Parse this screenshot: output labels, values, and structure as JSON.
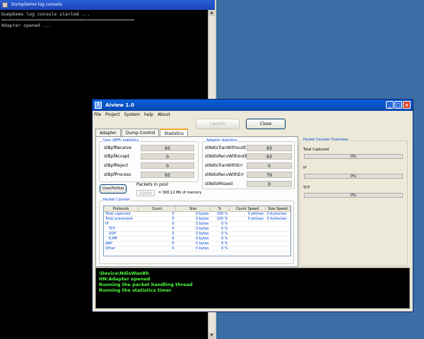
{
  "console": {
    "title": "DumpDemo log console",
    "lines": [
      "DumpDemo log console started ...",
      "================================================",
      "Adapter opened ..."
    ]
  },
  "app": {
    "title": "Aiview 1.0",
    "menu": [
      "File",
      "Project",
      "System",
      "help",
      "About"
    ],
    "buttons": {
      "launch": "Launch",
      "close": "Close",
      "clear": "ClearPktStat"
    },
    "tabs": [
      "Adapter",
      "Dump Control",
      "Statistics"
    ],
    "active_tab": 2,
    "user_stats": {
      "title": "User (BPF) statistics",
      "rows": [
        {
          "label": "stBpfReceive",
          "value": "93"
        },
        {
          "label": "stBpfAccept",
          "value": "0"
        },
        {
          "label": "stBpfReject",
          "value": "0"
        },
        {
          "label": "stBpfProcess",
          "value": "93"
        }
      ]
    },
    "adapter_stats": {
      "title": "Adapter statistics",
      "rows": [
        {
          "label": "stNdisTranWithoutErr",
          "value": "93"
        },
        {
          "label": "stNdisRecvWithoutErr",
          "value": "93"
        },
        {
          "label": "stNdisTranWithErr",
          "value": "0"
        },
        {
          "label": "stNdisRecvWithErr",
          "value": "79"
        },
        {
          "label": "stNdisMissed",
          "value": "0"
        }
      ]
    },
    "pool": {
      "label": "Packets in pool",
      "value": "25000",
      "note": "= 368,12 Mb of memory"
    },
    "packet_counter": {
      "title": "Packet Counter",
      "columns": [
        "Protocols",
        "Count",
        "Size",
        "%",
        "Count Speed",
        "Size Speed"
      ],
      "rows": [
        [
          "Total captured",
          "0",
          "0 bytes",
          "100 %",
          "0 pkt/sec",
          "0 bytes/sec"
        ],
        [
          "Total processed",
          "0",
          "0 bytes",
          "100 %",
          "0 pkt/sec",
          "0 bytes/sec"
        ],
        [
          "IP",
          "0",
          "0 bytes",
          "0 %",
          "",
          ""
        ],
        [
          "   TCP",
          "0",
          "0 bytes",
          "0 %",
          "",
          ""
        ],
        [
          "   UDP",
          "0",
          "0 bytes",
          "0 %",
          "",
          ""
        ],
        [
          "   ICMP",
          "0",
          "0 bytes",
          "0 %",
          "",
          ""
        ],
        [
          "ARP",
          "0",
          "0 bytes",
          "0 %",
          "",
          ""
        ],
        [
          "Other",
          "0",
          "0 bytes",
          "0 %",
          "",
          ""
        ]
      ]
    },
    "overview": {
      "title": "Packet Counter Overview",
      "bars": [
        {
          "label": "Total Captured",
          "value": "0%"
        },
        {
          "label": "IP",
          "value": "0%"
        },
        {
          "label": "TCP",
          "value": "0%"
        }
      ]
    },
    "log": [
      "\\Device\\NdisWanBh",
      "HN:Adapter opened",
      "Running the packet handling thread",
      "Running the statistics timer"
    ]
  }
}
